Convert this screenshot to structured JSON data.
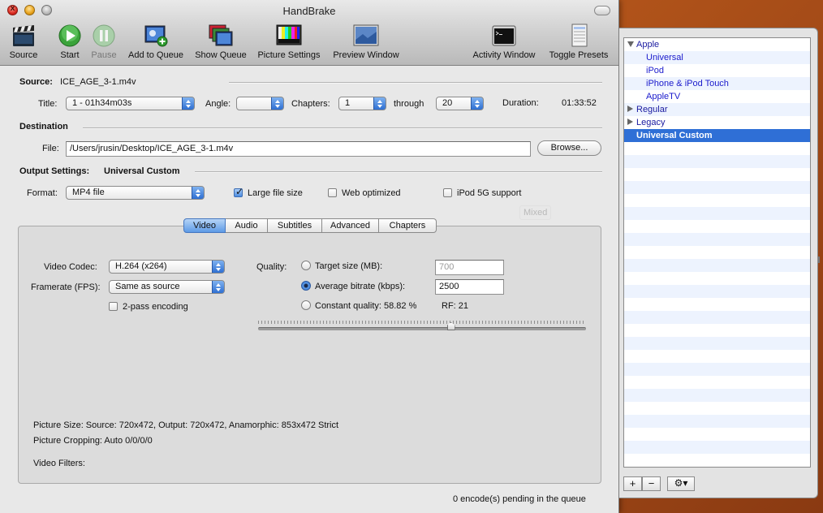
{
  "window": {
    "title": "HandBrake"
  },
  "toolbar": {
    "source": "Source",
    "start": "Start",
    "pause": "Pause",
    "add_to_queue": "Add to Queue",
    "show_queue": "Show Queue",
    "picture_settings": "Picture Settings",
    "preview_window": "Preview Window",
    "activity_window": "Activity Window",
    "toggle_presets": "Toggle Presets"
  },
  "source": {
    "label": "Source:",
    "value": "ICE_AGE_3-1.m4v"
  },
  "title_row": {
    "title_label": "Title:",
    "title_value": "1 - 01h34m03s",
    "angle_label": "Angle:",
    "angle_value": "",
    "chapters_label": "Chapters:",
    "chapter_from": "1",
    "through_label": "through",
    "chapter_to": "20",
    "duration_label": "Duration:",
    "duration_value": "01:33:52"
  },
  "destination": {
    "label": "Destination",
    "file_label": "File:",
    "file_value": "/Users/jrusin/Desktop/ICE_AGE_3-1.m4v",
    "browse": "Browse..."
  },
  "output": {
    "label": "Output Settings:",
    "preset_name": "Universal Custom",
    "format_label": "Format:",
    "format_value": "MP4 file",
    "large_file": "Large file size",
    "large_file_checked": true,
    "web_optimized": "Web optimized",
    "web_optimized_checked": false,
    "ipod_5g": "iPod 5G support",
    "ipod_5g_checked": false,
    "ghost_text": "Mixed"
  },
  "tabs": [
    {
      "label": "Video",
      "active": true
    },
    {
      "label": "Audio",
      "active": false
    },
    {
      "label": "Subtitles",
      "active": false
    },
    {
      "label": "Advanced",
      "active": false
    },
    {
      "label": "Chapters",
      "active": false
    }
  ],
  "video": {
    "codec_label": "Video Codec:",
    "codec_value": "H.264 (x264)",
    "framerate_label": "Framerate (FPS):",
    "framerate_value": "Same as source",
    "two_pass": "2-pass encoding",
    "quality_label": "Quality:",
    "target_size": "Target size (MB):",
    "target_size_value": "700",
    "avg_bitrate": "Average bitrate (kbps):",
    "avg_bitrate_value": "2500",
    "constant_quality": "Constant quality: 58.82 %",
    "rf": "RF: 21",
    "quality_slider_fraction": 0.5882,
    "picture_size": "Picture Size: Source: 720x472, Output: 720x472, Anamorphic: 853x472 Strict",
    "picture_cropping": "Picture Cropping: Auto 0/0/0/0",
    "video_filters": "Video Filters:"
  },
  "status": {
    "queue": "0 encode(s) pending in the queue"
  },
  "presets": {
    "rows": [
      {
        "label": "Apple",
        "kind": "group",
        "open": true
      },
      {
        "label": "Universal",
        "kind": "child"
      },
      {
        "label": "iPod",
        "kind": "child"
      },
      {
        "label": "iPhone & iPod Touch",
        "kind": "child"
      },
      {
        "label": "AppleTV",
        "kind": "child"
      },
      {
        "label": "Regular",
        "kind": "group",
        "open": false
      },
      {
        "label": "Legacy",
        "kind": "group",
        "open": false
      },
      {
        "label": "Universal Custom",
        "kind": "selected"
      }
    ],
    "add": "+",
    "remove": "−",
    "gear": "⚙▾"
  },
  "colors": {
    "accent": "#2f6fd6",
    "desktop": "#b2541a"
  }
}
